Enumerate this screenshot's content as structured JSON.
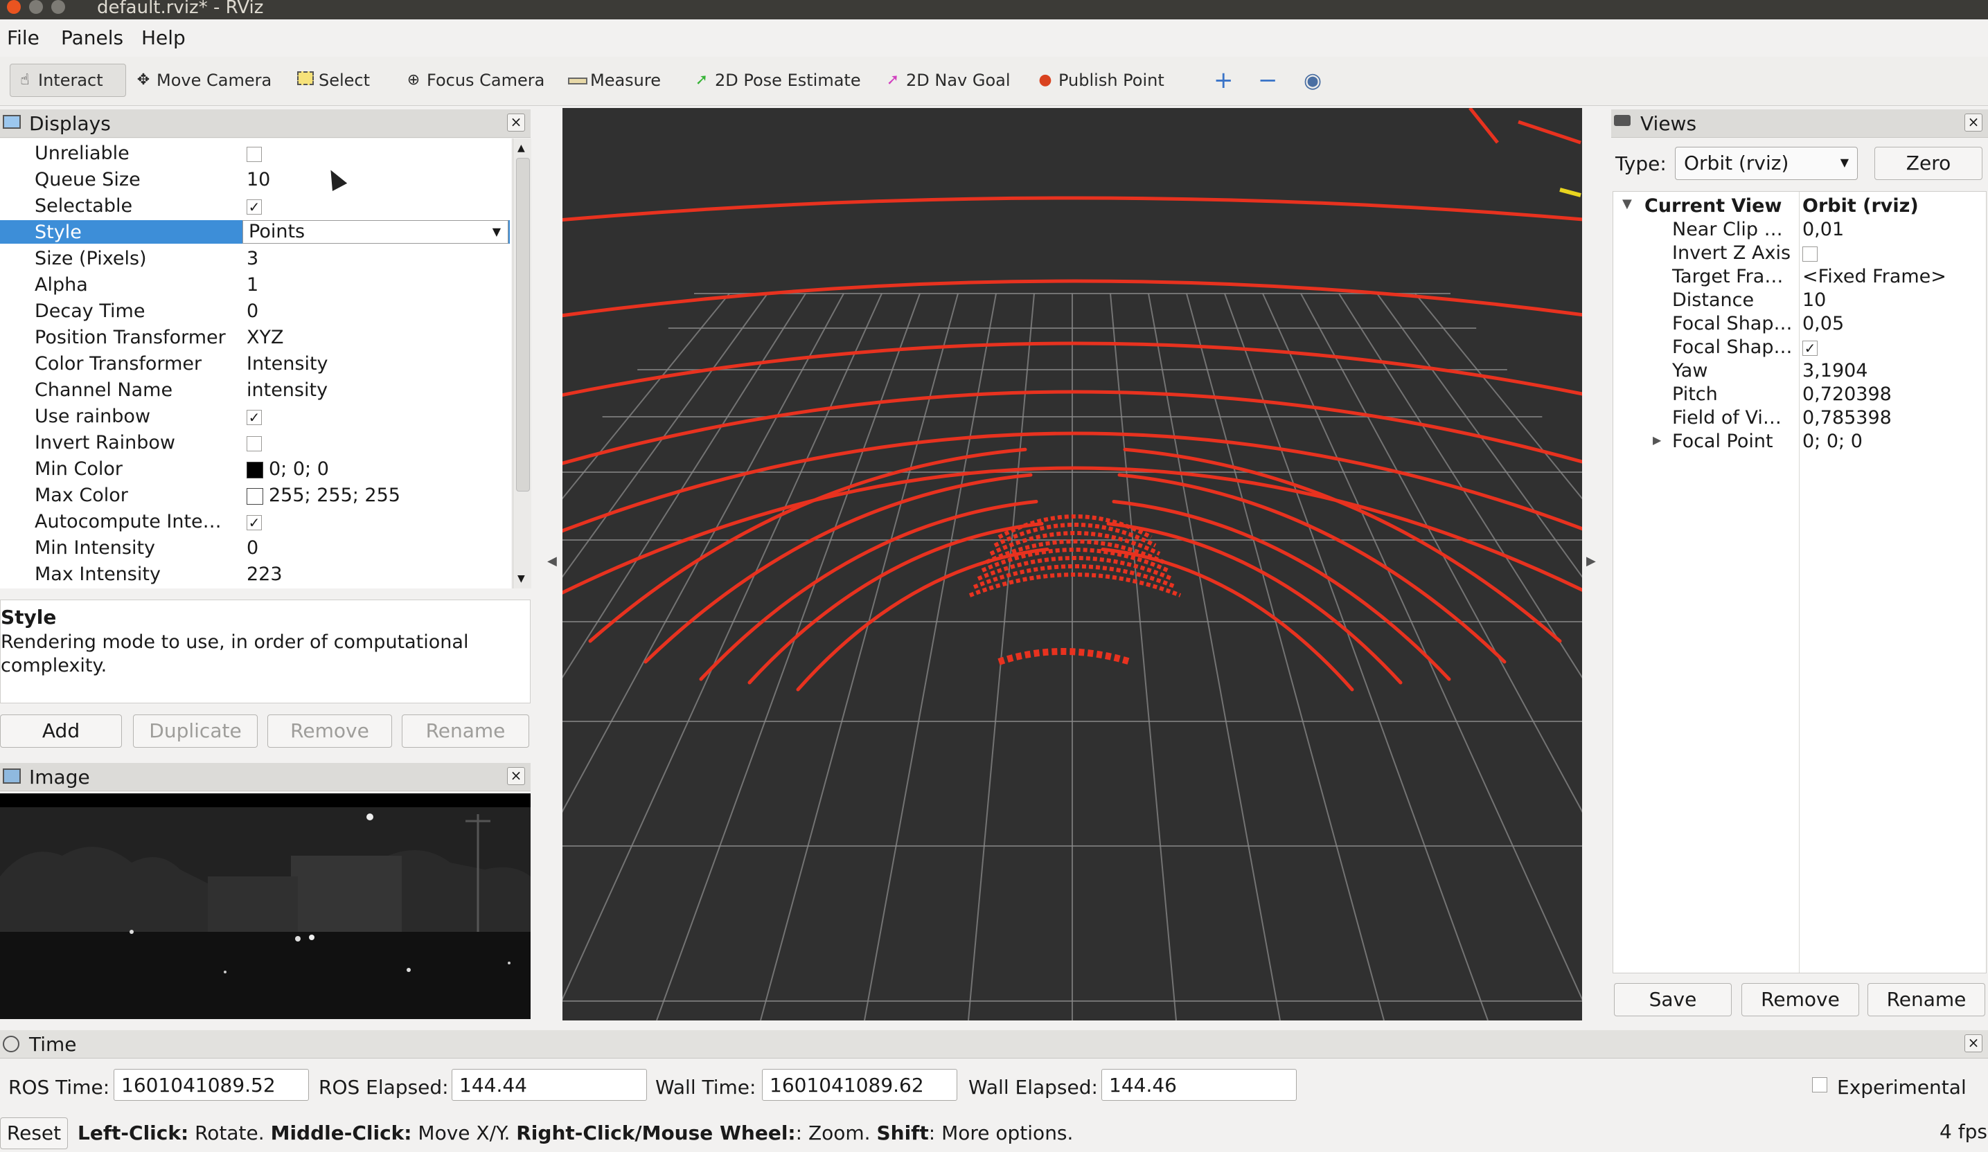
{
  "window": {
    "title": "default.rviz* - RViz"
  },
  "menu": {
    "file": "File",
    "panels": "Panels",
    "help": "Help"
  },
  "toolbar": {
    "interact": "Interact",
    "move_camera": "Move Camera",
    "select": "Select",
    "focus_camera": "Focus Camera",
    "measure": "Measure",
    "pose_estimate": "2D Pose Estimate",
    "nav_goal": "2D Nav Goal",
    "publish_point": "Publish Point"
  },
  "displays": {
    "title": "Displays",
    "rows": [
      {
        "key": "Unreliable",
        "value": "",
        "check": false
      },
      {
        "key": "Queue Size",
        "value": "10"
      },
      {
        "key": "Selectable",
        "value": "",
        "check": true
      },
      {
        "key": "Style",
        "value": "Points",
        "selected": true
      },
      {
        "key": "Size (Pixels)",
        "value": "3"
      },
      {
        "key": "Alpha",
        "value": "1"
      },
      {
        "key": "Decay Time",
        "value": "0"
      },
      {
        "key": "Position Transformer",
        "value": "XYZ"
      },
      {
        "key": "Color Transformer",
        "value": "Intensity"
      },
      {
        "key": "Channel Name",
        "value": "intensity"
      },
      {
        "key": "Use rainbow",
        "value": "",
        "check": true
      },
      {
        "key": "Invert Rainbow",
        "value": "",
        "check": false
      },
      {
        "key": "Min Color",
        "value": "0; 0; 0",
        "swatch": "#000000"
      },
      {
        "key": "Max Color",
        "value": "255; 255; 255",
        "swatch": "#ffffff"
      },
      {
        "key": "Autocompute Inte…",
        "value": "",
        "check": true
      },
      {
        "key": "Min Intensity",
        "value": "0"
      },
      {
        "key": "Max Intensity",
        "value": "223"
      }
    ],
    "desc_title": "Style",
    "desc_text": "Rendering mode to use, in order of computational complexity.",
    "buttons": {
      "add": "Add",
      "duplicate": "Duplicate",
      "remove": "Remove",
      "rename": "Rename"
    }
  },
  "image_panel": {
    "title": "Image"
  },
  "views": {
    "title": "Views",
    "type_label": "Type:",
    "type_value": "Orbit (rviz)",
    "zero": "Zero",
    "current_view": "Current View",
    "current_view_type": "Orbit (rviz)",
    "rows": [
      {
        "key": "Near Clip …",
        "value": "0,01"
      },
      {
        "key": "Invert Z Axis",
        "value": "",
        "check": false
      },
      {
        "key": "Target Fra…",
        "value": "<Fixed Frame>"
      },
      {
        "key": "Distance",
        "value": "10"
      },
      {
        "key": "Focal Shap…",
        "value": "0,05"
      },
      {
        "key": "Focal Shap…",
        "value": "",
        "check": true
      },
      {
        "key": "Yaw",
        "value": "3,1904"
      },
      {
        "key": "Pitch",
        "value": "0,720398"
      },
      {
        "key": "Field of Vi…",
        "value": "0,785398"
      },
      {
        "key": "Focal Point",
        "value": "0; 0; 0"
      }
    ],
    "buttons": {
      "save": "Save",
      "remove": "Remove",
      "rename": "Rename"
    }
  },
  "time": {
    "title": "Time",
    "ros_time_label": "ROS Time:",
    "ros_time": "1601041089.52",
    "ros_elapsed_label": "ROS Elapsed:",
    "ros_elapsed": "144.44",
    "wall_time_label": "Wall Time:",
    "wall_time": "1601041089.62",
    "wall_elapsed_label": "Wall Elapsed:",
    "wall_elapsed": "144.46",
    "experimental": "Experimental"
  },
  "status": {
    "reset": "Reset",
    "left_click": "Left-Click:",
    "left_click_action": "Rotate.",
    "middle_click": "Middle-Click:",
    "middle_click_action": "Move X/Y.",
    "right_click": "Right-Click/Mouse Wheel:",
    "right_click_action": ": Zoom.",
    "shift": "Shift",
    "shift_action": ": More options.",
    "fps": "4 fps"
  },
  "colors": {
    "selection": "#3d8ed8",
    "lidar": "#e8321f",
    "viewport_bg": "#303030",
    "grid": "#8a8a8a"
  }
}
